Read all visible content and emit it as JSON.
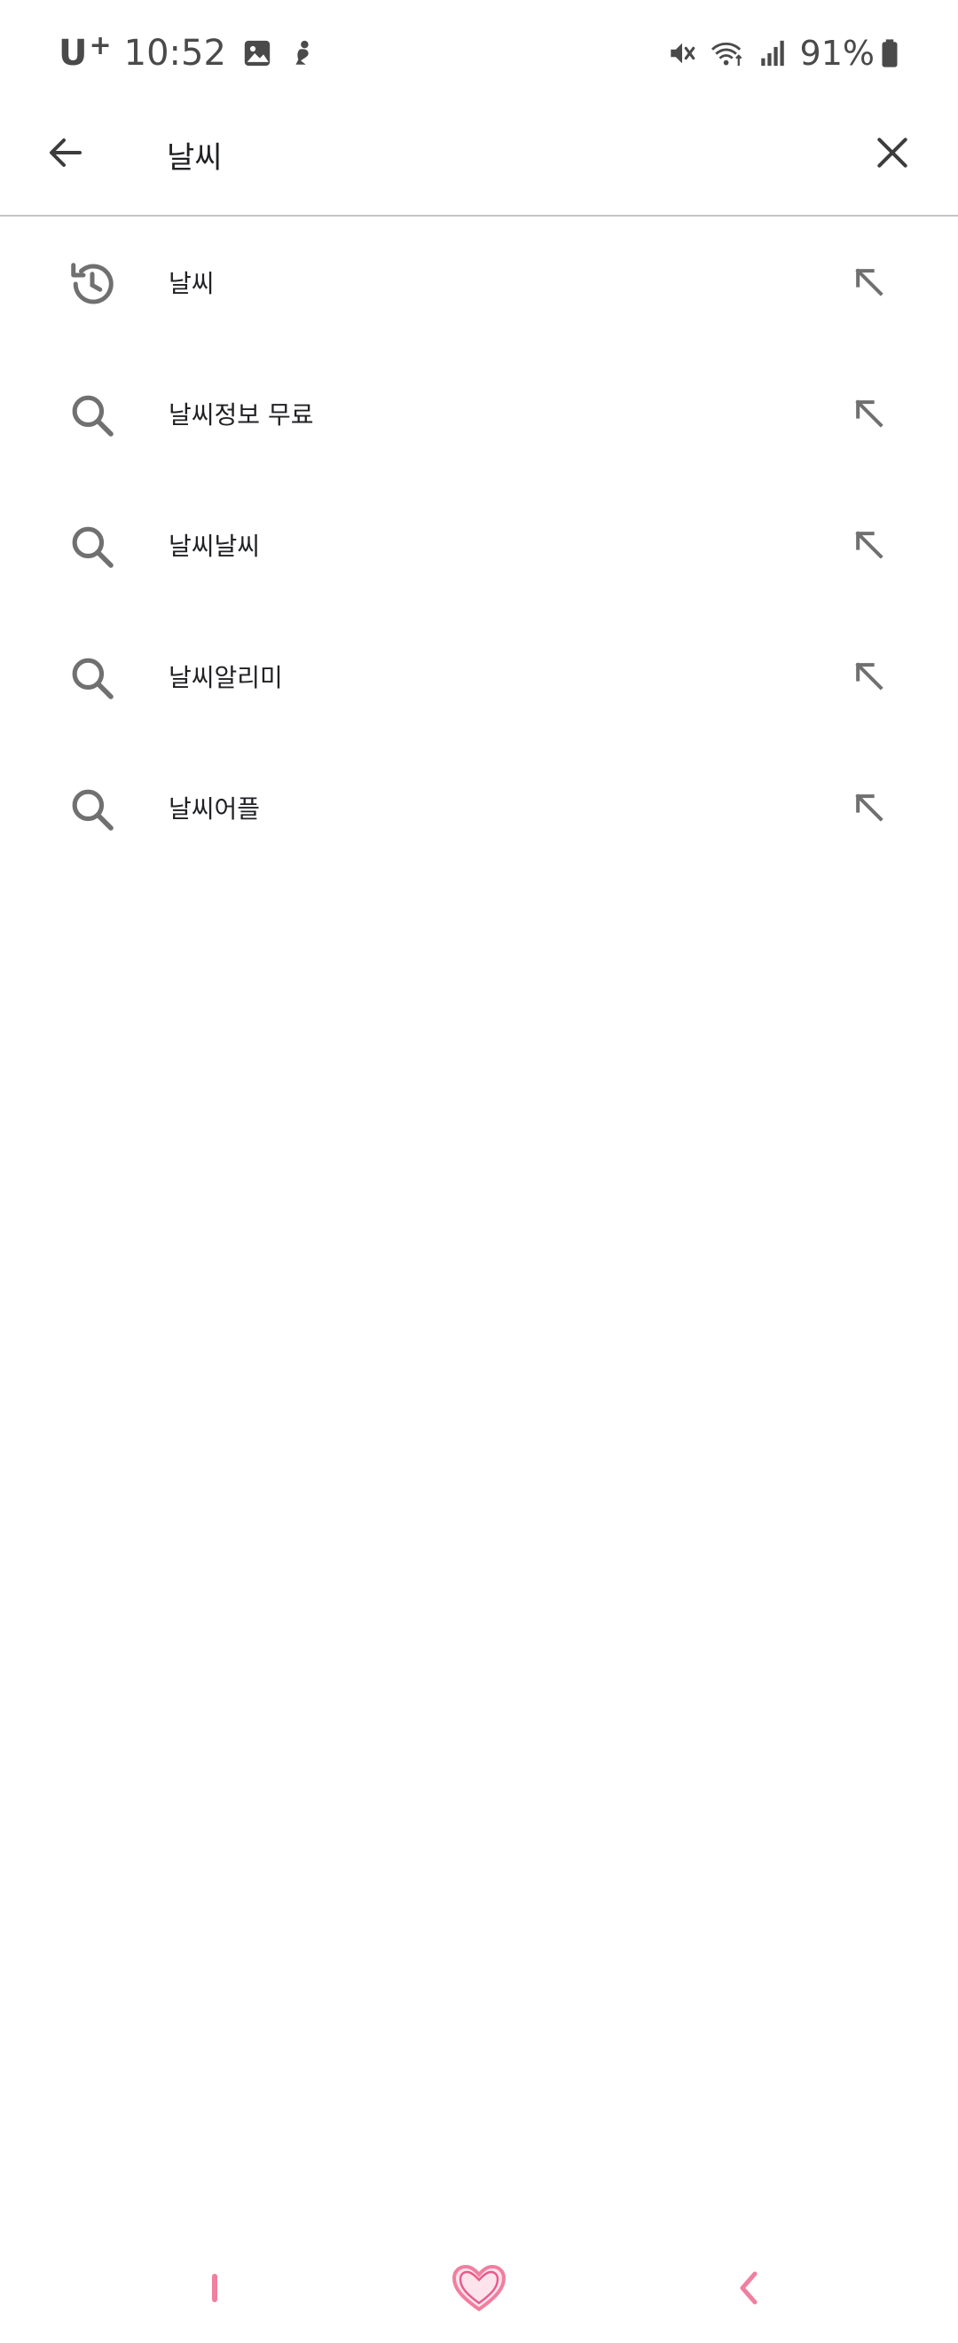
{
  "status_bar": {
    "carrier": "U",
    "carrier_sup": "+",
    "time": "10:52",
    "battery": "91%",
    "icons_left": [
      "gallery-icon",
      "mermaid-icon"
    ],
    "icons_right": [
      "mute-icon",
      "wifi-icon",
      "signal-icon",
      "battery-icon"
    ]
  },
  "search": {
    "query": "날씨",
    "back_icon": "arrow-left-icon",
    "clear_icon": "close-icon"
  },
  "suggestions": [
    {
      "text": "날씨",
      "type": "history",
      "icon": "history-icon",
      "action_icon": "arrow-up-left-icon"
    },
    {
      "text": "날씨정보 무료",
      "type": "search",
      "icon": "search-icon",
      "action_icon": "arrow-up-left-icon"
    },
    {
      "text": "날씨날씨",
      "type": "search",
      "icon": "search-icon",
      "action_icon": "arrow-up-left-icon"
    },
    {
      "text": "날씨알리미",
      "type": "search",
      "icon": "search-icon",
      "action_icon": "arrow-up-left-icon"
    },
    {
      "text": "날씨어플",
      "type": "search",
      "icon": "search-icon",
      "action_icon": "arrow-up-left-icon"
    }
  ],
  "nav_bar": {
    "buttons": [
      "recents-icon",
      "home-heart-icon",
      "back-chevron-icon"
    ],
    "accent_color": "#f07fa0"
  },
  "colors": {
    "icon_gray": "#707070",
    "text": "#202124",
    "divider": "#c4c4c4"
  }
}
